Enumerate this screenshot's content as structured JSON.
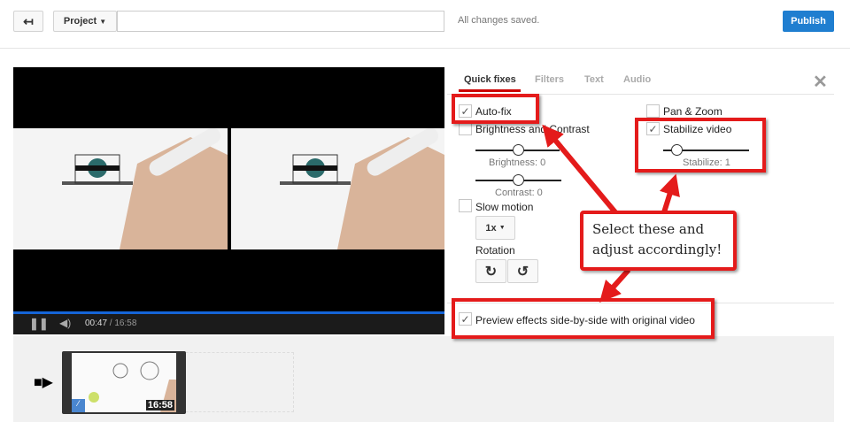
{
  "topbar": {
    "back_icon": "undo-arrow-icon",
    "project_label": "Project",
    "title_value": "",
    "status": "All changes saved.",
    "publish_label": "Publish"
  },
  "player": {
    "current_time": "00:47",
    "separator": " / ",
    "duration": "16:58",
    "progress": 0.046
  },
  "tabs": [
    {
      "label": "Quick fixes",
      "active": true
    },
    {
      "label": "Filters"
    },
    {
      "label": "Text"
    },
    {
      "label": "Audio"
    }
  ],
  "quick_fixes": {
    "auto_fix": {
      "label": "Auto-fix",
      "checked": true
    },
    "brightness_contrast": {
      "label": "Brightness and Contrast",
      "checked": false
    },
    "brightness_label": "Brightness: 0",
    "contrast_label": "Contrast: 0",
    "slow_motion": {
      "label": "Slow motion",
      "checked": false
    },
    "speed_value": "1x",
    "rotation_label": "Rotation",
    "pan_zoom": {
      "label": "Pan & Zoom",
      "checked": false
    },
    "stabilize": {
      "label": "Stabilize video",
      "checked": true
    },
    "stabilize_label": "Stabilize: 1",
    "preview": {
      "label": "Preview effects side-by-side with original video",
      "checked": true
    }
  },
  "annotation": {
    "callout_line1": "Select these and",
    "callout_line2": "adjust accordingly!",
    "color": "#e41b1b"
  },
  "timeline": {
    "clip_duration": "16:58"
  }
}
